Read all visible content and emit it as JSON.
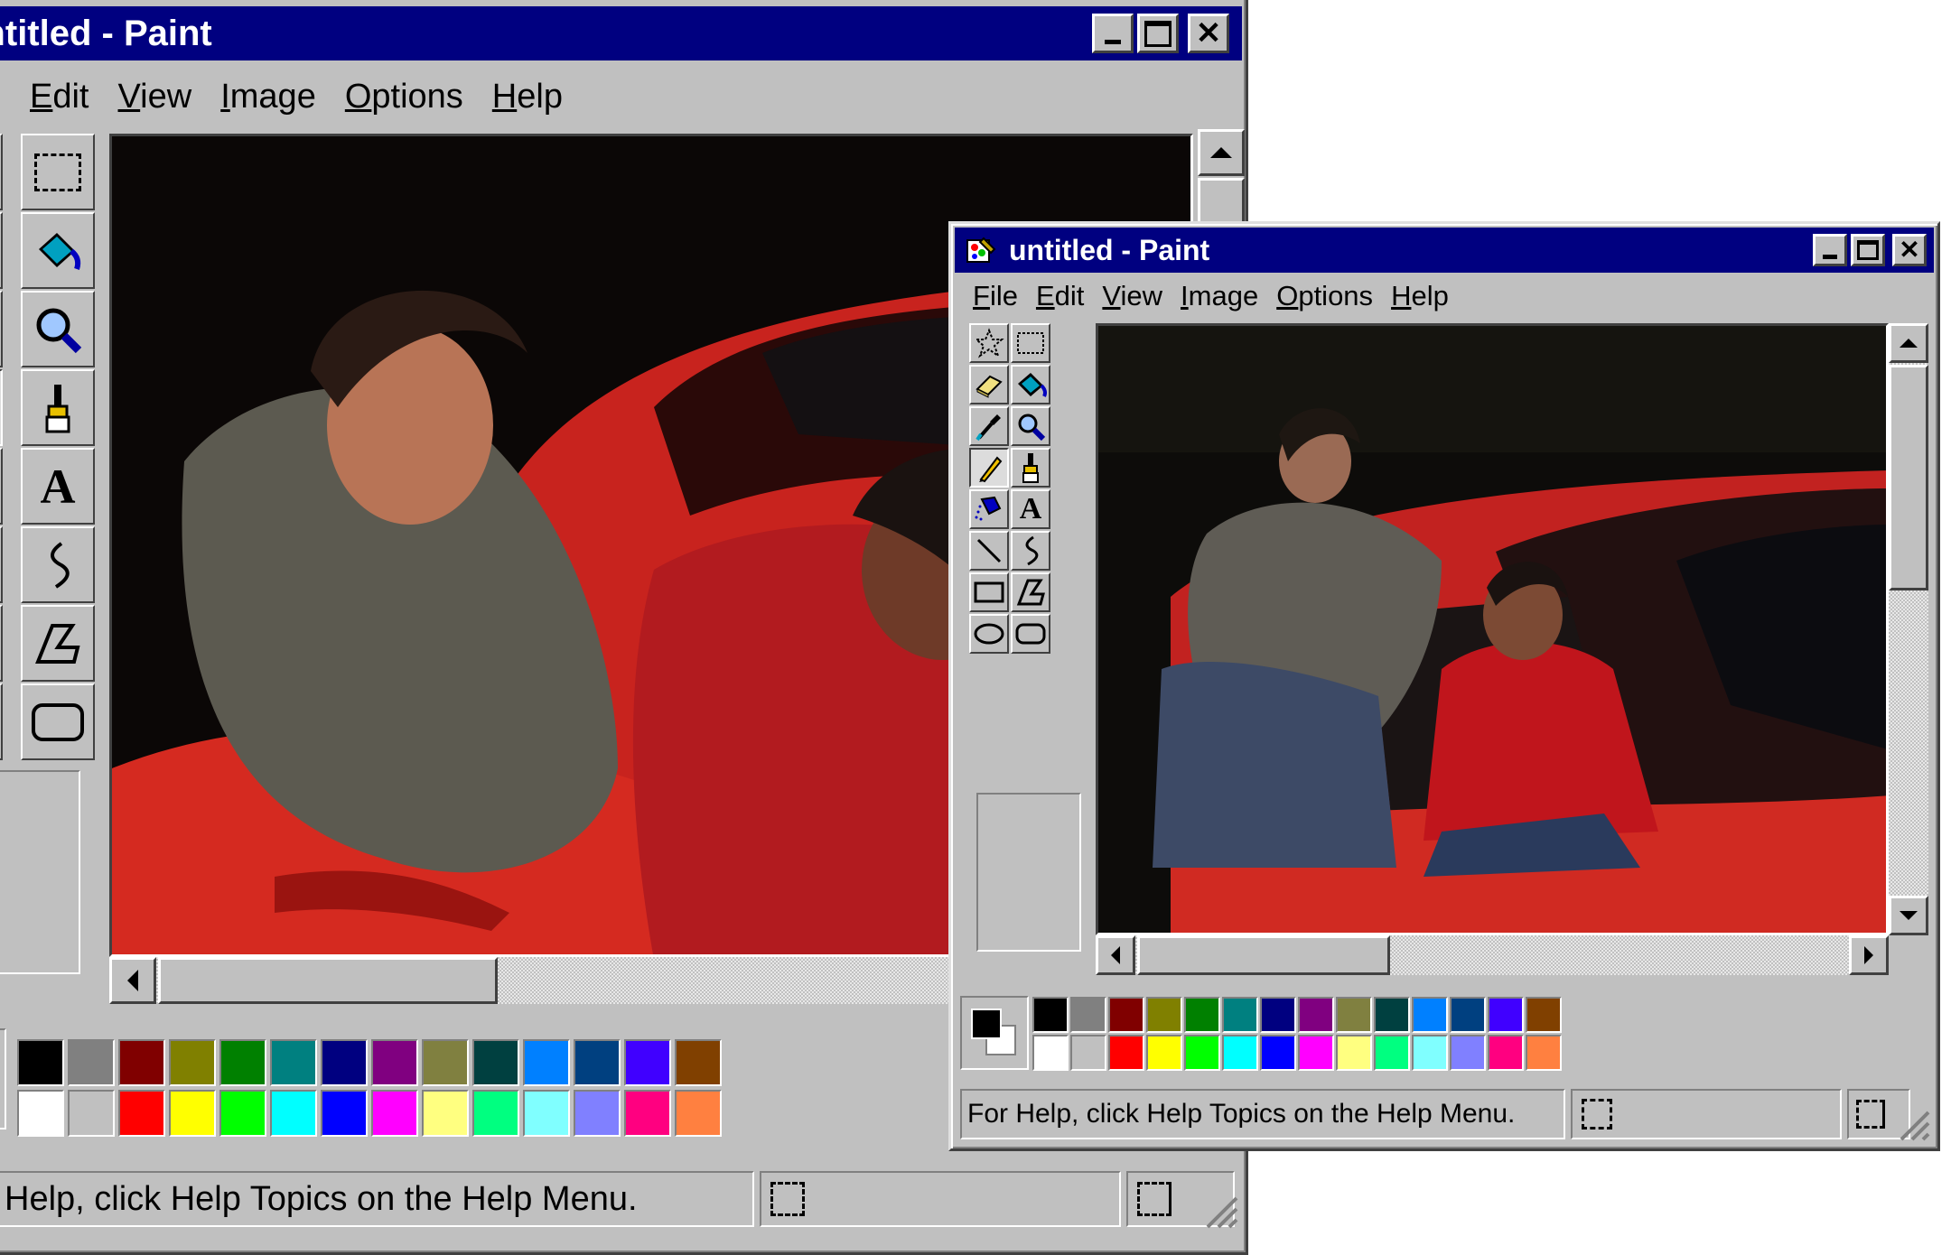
{
  "window_back": {
    "title": "untitled - Paint",
    "menu": [
      {
        "label": "Edit",
        "accel": "E"
      },
      {
        "label": "View",
        "accel": "V"
      },
      {
        "label": "Image",
        "accel": "I"
      },
      {
        "label": "Options",
        "accel": "O"
      },
      {
        "label": "Help",
        "accel": "H"
      }
    ],
    "status_text": "Help, click Help Topics on the Help Menu."
  },
  "window_front": {
    "title": "untitled - Paint",
    "menu": [
      {
        "label": "File",
        "accel": "F"
      },
      {
        "label": "Edit",
        "accel": "E"
      },
      {
        "label": "View",
        "accel": "V"
      },
      {
        "label": "Image",
        "accel": "I"
      },
      {
        "label": "Options",
        "accel": "O"
      },
      {
        "label": "Help",
        "accel": "H"
      }
    ],
    "status_text": "For Help, click Help Topics on the Help Menu."
  },
  "tools": [
    {
      "name": "free-form-select-icon"
    },
    {
      "name": "select-icon"
    },
    {
      "name": "eraser-icon"
    },
    {
      "name": "fill-bucket-icon"
    },
    {
      "name": "pick-color-icon"
    },
    {
      "name": "magnifier-icon"
    },
    {
      "name": "pencil-icon",
      "active": true
    },
    {
      "name": "brush-icon"
    },
    {
      "name": "airbrush-icon"
    },
    {
      "name": "text-icon",
      "glyph": "A"
    },
    {
      "name": "line-icon"
    },
    {
      "name": "curve-icon"
    },
    {
      "name": "rectangle-icon"
    },
    {
      "name": "polygon-icon"
    },
    {
      "name": "ellipse-icon"
    },
    {
      "name": "rounded-rectangle-icon"
    }
  ],
  "palette": {
    "foreground": "#000000",
    "background": "#ffffff",
    "row1": [
      "#000000",
      "#808080",
      "#800000",
      "#808000",
      "#008000",
      "#008080",
      "#000080",
      "#800080",
      "#808040",
      "#004040",
      "#0080ff",
      "#004080",
      "#4000ff",
      "#804000"
    ],
    "row2": [
      "#ffffff",
      "#c0c0c0",
      "#ff0000",
      "#ffff00",
      "#00ff00",
      "#00ffff",
      "#0000ff",
      "#ff00ff",
      "#ffff80",
      "#00ff80",
      "#80ffff",
      "#8080ff",
      "#ff0080",
      "#ff8040"
    ]
  },
  "colors": {
    "titlebar": "#000080",
    "face": "#c0c0c0"
  }
}
